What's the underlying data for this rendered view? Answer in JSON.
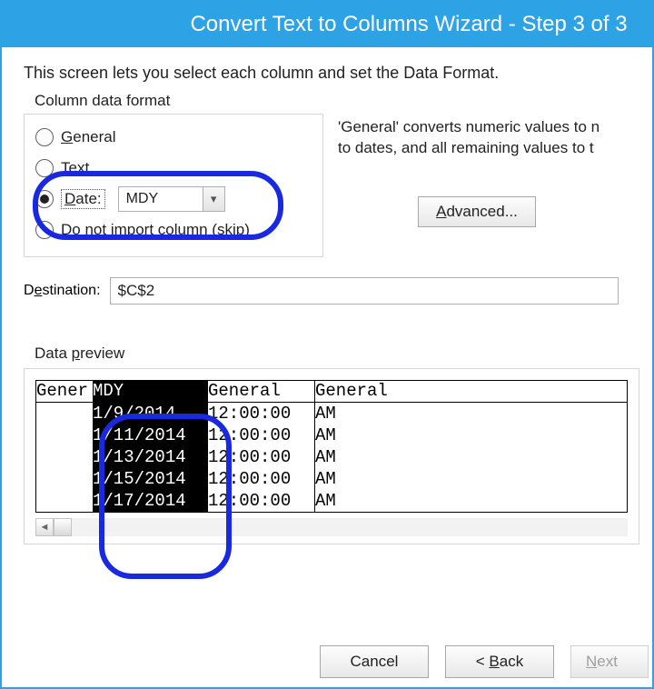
{
  "title": "Convert Text to Columns Wizard - Step 3 of 3",
  "intro": "This screen lets you select each column and set the Data Format.",
  "colFormat": {
    "label": "Column data format",
    "general": "General",
    "general_u": "G",
    "text": "Text",
    "text_u": "T",
    "date": "Date:",
    "date_u": "D",
    "dateFormat": "MDY",
    "skip": "Do not import column (skip)",
    "skip_u": "i"
  },
  "note_line1": "'General' converts numeric values to n",
  "note_line2": "to dates, and all remaining values to t",
  "advanced": "Advanced...",
  "advanced_u": "A",
  "destination_label": "Destination:",
  "destination_u": "e",
  "destination_value": "$C$2",
  "preview_label": "Data preview",
  "preview_label_u": "p",
  "chart_data": {
    "type": "table",
    "headers": [
      "General",
      "MDY",
      "General",
      "General"
    ],
    "selected_column_index": 1,
    "rows": [
      [
        "",
        "1/9/2014",
        "12:00:00",
        "AM"
      ],
      [
        "",
        "1/11/2014",
        "12:00:00",
        "AM"
      ],
      [
        "",
        "1/13/2014",
        "12:00:00",
        "AM"
      ],
      [
        "",
        "1/15/2014",
        "12:00:00",
        "AM"
      ],
      [
        "",
        "1/17/2014",
        "12:00:00",
        "AM"
      ]
    ]
  },
  "header_c1": "Gener",
  "header_c2": "MDY",
  "header_c3": "General",
  "header_c4": "General",
  "body_c1": "\n\n\n\n",
  "body_c2": "1/9/2014 \n1/11/2014\n1/13/2014\n1/15/2014\n1/17/2014",
  "body_c3": "12:00:00\n12:00:00\n12:00:00\n12:00:00\n12:00:00",
  "body_c4": "AM\nAM\nAM\nAM\nAM",
  "buttons": {
    "cancel": "Cancel",
    "back": "< Back",
    "back_u": "B",
    "next": "Next >",
    "next_u": "N"
  }
}
